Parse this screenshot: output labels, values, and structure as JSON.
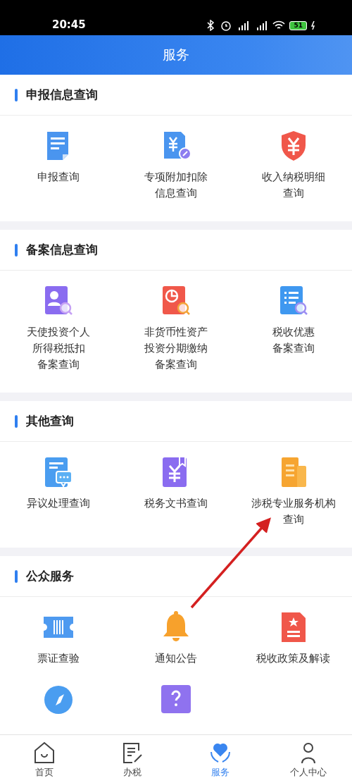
{
  "status_bar": {
    "time": "20:45",
    "battery": "51"
  },
  "header": {
    "title": "服务"
  },
  "sections": [
    {
      "title": "申报信息查询",
      "items": [
        {
          "kind": "doc",
          "lines": [
            "申报查询"
          ]
        },
        {
          "kind": "yen-edit",
          "lines": [
            "专项附加扣除",
            "信息查询"
          ]
        },
        {
          "kind": "shield",
          "lines": [
            "收入纳税明细",
            "查询"
          ]
        }
      ]
    },
    {
      "title": "备案信息查询",
      "items": [
        {
          "kind": "person-search",
          "lines": [
            "天使投资个人",
            "所得税抵扣",
            "备案查询"
          ]
        },
        {
          "kind": "chart-search",
          "lines": [
            "非货币性资产",
            "投资分期缴纳",
            "备案查询"
          ]
        },
        {
          "kind": "list-search",
          "lines": [
            "税收优惠",
            "备案查询"
          ]
        }
      ]
    },
    {
      "title": "其他查询",
      "items": [
        {
          "kind": "chat-doc",
          "lines": [
            "异议处理查询"
          ]
        },
        {
          "kind": "yen-book",
          "lines": [
            "税务文书查询"
          ]
        },
        {
          "kind": "building",
          "lines": [
            "涉税专业服务机构",
            "查询"
          ]
        }
      ]
    },
    {
      "title": "公众服务",
      "items": [
        {
          "kind": "ticket",
          "lines": [
            "票证查验"
          ]
        },
        {
          "kind": "bell",
          "lines": [
            "通知公告"
          ]
        },
        {
          "kind": "star-doc",
          "lines": [
            "税收政策及解读"
          ]
        },
        {
          "kind": "compass"
        },
        {
          "kind": "question"
        }
      ]
    }
  ],
  "nav": [
    {
      "kind": "home",
      "label": "首页",
      "selected": false
    },
    {
      "kind": "pen",
      "label": "办税",
      "selected": false
    },
    {
      "kind": "heart",
      "label": "服务",
      "selected": true
    },
    {
      "kind": "person",
      "label": "个人中心",
      "selected": false
    }
  ]
}
